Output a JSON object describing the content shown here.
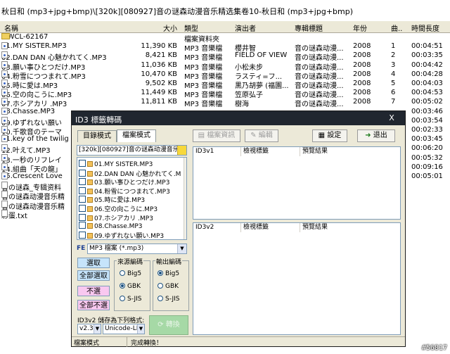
{
  "window": {
    "title": "秋日和 (mp3+jpg+bmp)\\[320k][080927]音の谜森动漫音乐精选集卷10-秋日和 (mp3+jpg+bmp)"
  },
  "columns": {
    "name": "名稱",
    "size": "大小",
    "type": "類型",
    "artist": "演出者",
    "album": "專輯標題",
    "year": "年份",
    "track": "曲..",
    "duration": "時間長度"
  },
  "files": [
    {
      "name": "MWCL-62167",
      "size": "",
      "type": "檔案資料夾",
      "artist": "",
      "album": "",
      "year": "",
      "track": "",
      "duration": "",
      "icon": "folder-icon"
    },
    {
      "name": "01.MY SISTER.MP3",
      "size": "11,390 KB",
      "type": "MP3 音樂檔",
      "artist": "櫻井智",
      "album": "音の谜森动漫...",
      "year": "2008",
      "track": "1",
      "duration": "00:04:51",
      "icon": "mp3-file-icon"
    },
    {
      "name": "02.DAN DAN 心魅かれてく.MP3",
      "size": "8,421 KB",
      "type": "MP3 音樂檔",
      "artist": "FIELD OF VIEW",
      "album": "音の谜森动漫...",
      "year": "2008",
      "track": "2",
      "duration": "00:03:35",
      "icon": "mp3-file-icon"
    },
    {
      "name": "03.願い事ひとつだけ.MP3",
      "size": "11,036 KB",
      "type": "MP3 音樂檔",
      "artist": "小松未步",
      "album": "音の谜森动漫...",
      "year": "2008",
      "track": "3",
      "duration": "00:04:42",
      "icon": "mp3-file-icon"
    },
    {
      "name": "04.粉雪につつまれて.MP3",
      "size": "10,470 KB",
      "type": "MP3 音樂檔",
      "artist": "ラスティ=フ...",
      "album": "音の谜森动漫...",
      "year": "2008",
      "track": "4",
      "duration": "00:04:28",
      "icon": "mp3-file-icon"
    },
    {
      "name": "05.時に愛は.MP3",
      "size": "9,502 KB",
      "type": "MP3 音樂檔",
      "artist": "黒乃胡夢 (福園...",
      "album": "音の谜森动漫...",
      "year": "2008",
      "track": "5",
      "duration": "00:04:03",
      "icon": "mp3-file-icon"
    },
    {
      "name": "06.空の向こうに.MP3",
      "size": "11,449 KB",
      "type": "MP3 音樂檔",
      "artist": "笠原弘子",
      "album": "音の谜森动漫...",
      "year": "2008",
      "track": "6",
      "duration": "00:04:53",
      "icon": "mp3-file-icon"
    },
    {
      "name": "07.ホシアカリ .MP3",
      "size": "11,811 KB",
      "type": "MP3 音樂檔",
      "artist": "樹海",
      "album": "音の谜森动漫...",
      "year": "2008",
      "track": "7",
      "duration": "00:05:02",
      "icon": "mp3-file-icon"
    },
    {
      "name": "08.Chasse.MP3",
      "size": "",
      "type": "",
      "artist": "",
      "album": "",
      "year": "",
      "track": "",
      "duration": "00:03:46",
      "icon": "mp3-file-icon"
    },
    {
      "name": "09.ゆずれない願い",
      "size": "",
      "type": "",
      "artist": "",
      "album": "",
      "year": "",
      "track": "",
      "duration": "00:03:54",
      "icon": "mp3-file-icon"
    },
    {
      "name": "10.千歌音のテーマ",
      "size": "",
      "type": "",
      "artist": "",
      "album": "",
      "year": "",
      "track": "",
      "duration": "00:02:33",
      "icon": "mp3-file-icon"
    },
    {
      "name": "11.key of the twilig",
      "size": "",
      "type": "",
      "artist": "",
      "album": "",
      "year": "",
      "track": "",
      "duration": "00:03:45",
      "icon": "mp3-file-icon"
    },
    {
      "name": "12.叶えて.MP3",
      "size": "",
      "type": "",
      "artist": "",
      "album": "",
      "year": "",
      "track": "",
      "duration": "00:06:20",
      "icon": "mp3-file-icon"
    },
    {
      "name": "13.一秒のリフレイ",
      "size": "",
      "type": "",
      "artist": "",
      "album": "",
      "year": "",
      "track": "",
      "duration": "00:05:32",
      "icon": "mp3-file-icon"
    },
    {
      "name": "14.組曲「天の龍」",
      "size": "",
      "type": "",
      "artist": "",
      "album": "",
      "year": "",
      "track": "",
      "duration": "00:09:16",
      "icon": "mp3-file-icon"
    },
    {
      "name": "15.Crescent Love",
      "size": "",
      "type": "",
      "artist": "",
      "album": "",
      "year": "",
      "track": "",
      "duration": "00:05:01",
      "icon": "mp3-file-icon"
    },
    {
      "name": "音の谜森_专辑资料",
      "size": "",
      "type": "",
      "artist": "",
      "album": "",
      "year": "",
      "track": "",
      "duration": "",
      "icon": "text-file-icon"
    },
    {
      "name": "音の谜森动漫音乐精",
      "size": "",
      "type": "",
      "artist": "",
      "album": "",
      "year": "",
      "track": "",
      "duration": "",
      "icon": "text-file-icon"
    },
    {
      "name": "音の谜森动漫音乐精",
      "size": "",
      "type": "",
      "artist": "",
      "album": "",
      "year": "",
      "track": "",
      "duration": "",
      "icon": "text-file-icon"
    },
    {
      "name": "彩蛋.txt",
      "size": "",
      "type": "",
      "artist": "",
      "album": "",
      "year": "",
      "track": "",
      "duration": "",
      "icon": "text-file-icon"
    }
  ],
  "dialog": {
    "title": "ID3 標籤轉碼",
    "close": "X",
    "tabs": {
      "dir": "目錄模式",
      "file": "檔案模式"
    },
    "toolbar": {
      "file_info": "檔案資訊",
      "edit": "編輯",
      "settings": "設定",
      "exit": "退出"
    },
    "path_combo": "[320k][080927]音の谜森动漫音乐精选",
    "list_items": [
      "01.MY SISTER.MP3",
      "02.DAN DAN 心魅かれてく.M",
      "03.願い事ひとつだけ.MP3",
      "04.粉雪につつまれて.MP3",
      "05.時に愛は.MP3",
      "06.空の向こうに.MP3",
      "07.ホシアカリ .MP3",
      "08.Chasse.MP3",
      "09.ゆずれない願い.MP3"
    ],
    "filter_label": "FE",
    "filter": "MP3 檔案 (*.mp3)",
    "buttons": {
      "select": "選取",
      "select_all": "全部選取",
      "deselect": "不選",
      "deselect_all": "全部不選"
    },
    "src_group": "來源編碼",
    "out_group": "輸出編碼",
    "src_options": [
      "Big5",
      "GBK",
      "S-JIS"
    ],
    "out_options": [
      "Big5",
      "GBK",
      "S-JIS"
    ],
    "src_selected": "GBK",
    "out_selected": "Big5",
    "save_label": "ID3v2 儲存為下列格式:",
    "version": "v2.3",
    "encoding": "Unicode-LE",
    "convert": "轉換",
    "table1": {
      "label": "ID3v1",
      "col1": "檢視標籤",
      "col2": "預覽結果"
    },
    "table2": {
      "label": "ID3v2",
      "col1": "檢視標籤",
      "col2": "預覽結果"
    },
    "status": {
      "mode": "檔案模式",
      "state": "完成轉換！"
    }
  },
  "watermark": "#56817",
  "colors": {
    "title_bar": "#20262f",
    "face": "#ece9d8",
    "select_btn": "#c6e4fb",
    "deselect_btn": "#f9c8f0",
    "convert_btn": "#a6d9a6"
  }
}
